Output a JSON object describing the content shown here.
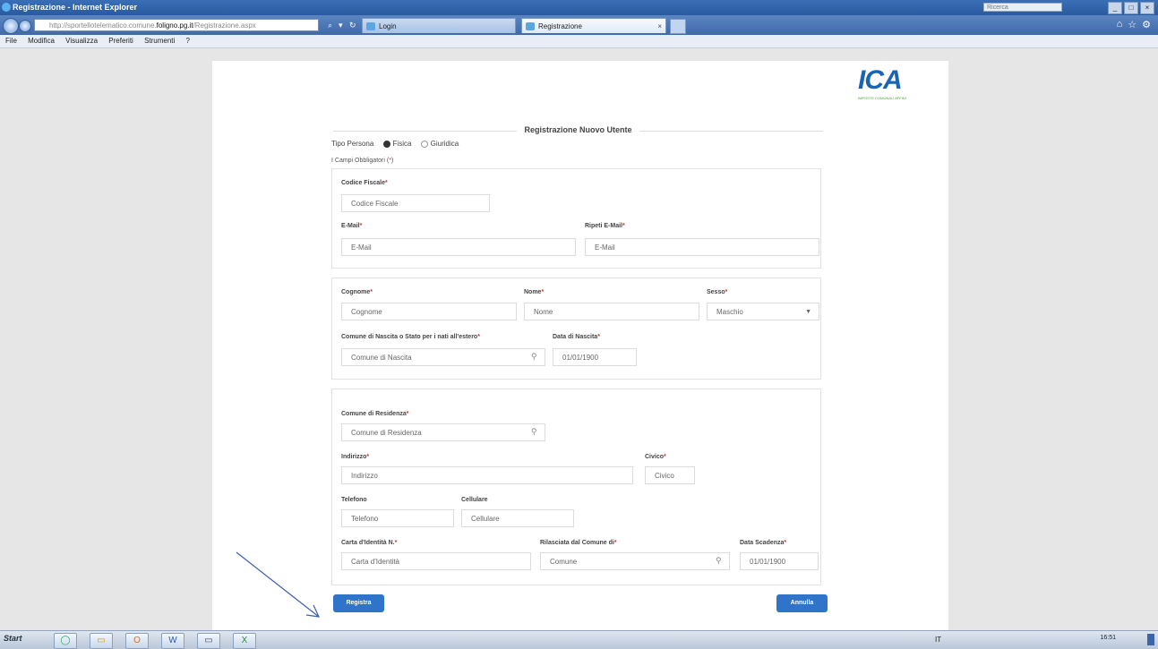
{
  "window": {
    "title": "Registrazione - Internet Explorer",
    "search_placeholder": "Ricerca",
    "buttons": [
      "_",
      "□",
      "×"
    ]
  },
  "browser": {
    "address_prefix": "http://sportellotelematico.comune.",
    "address_domain": "foligno.pg.it",
    "address_suffix": "/Registrazione.aspx",
    "search_glyph": "⌕",
    "go_glyph": "▾",
    "refresh_glyph": "↻",
    "tabs": [
      {
        "label": "Login",
        "close": ""
      },
      {
        "label": "Registrazione",
        "close": "×"
      }
    ],
    "right_icons": [
      "⌂",
      "☆",
      "⚙"
    ]
  },
  "menu": [
    "File",
    "Modifica",
    "Visualizza",
    "Preferiti",
    "Strumenti",
    "?"
  ],
  "logo": {
    "text": "ICA",
    "tagline": "IMPOSTE COMUNALI AFFINI"
  },
  "form": {
    "title": "Registrazione Nuovo Utente",
    "tipo_label": "Tipo Persona",
    "tipo_options": [
      "Fisica",
      "Giuridica"
    ],
    "tipo_selected": "Fisica",
    "required_note": "I Campi Obbligatori (",
    "star": "*",
    "required_close": ")",
    "section1": {
      "codice_fiscale_label": "Codice Fiscale",
      "codice_fiscale_placeholder": "Codice Fiscale",
      "email_label": "E-Mail",
      "email_placeholder": "E-Mail",
      "ripeti_email_label": "Ripeti E-Mail",
      "ripeti_email_placeholder": "E-Mail"
    },
    "section2": {
      "cognome_label": "Cognome",
      "cognome_placeholder": "Cognome",
      "nome_label": "Nome",
      "nome_placeholder": "Nome",
      "sesso_label": "Sesso",
      "sesso_value": "Maschio",
      "comune_nascita_label": "Comune di Nascita o Stato per i nati all'estero",
      "comune_nascita_placeholder": "Comune di Nascita",
      "data_nascita_label": "Data di Nascita",
      "data_nascita_value": "01/01/1900"
    },
    "section3": {
      "comune_residenza_label": "Comune di Residenza",
      "comune_residenza_placeholder": "Comune di Residenza",
      "indirizzo_label": "Indirizzo",
      "indirizzo_placeholder": "Indirizzo",
      "civico_label": "Civico",
      "civico_placeholder": "Civico",
      "telefono_label": "Telefono",
      "telefono_placeholder": "Telefono",
      "cellulare_label": "Cellulare",
      "cellulare_placeholder": "Cellulare",
      "carta_label": "Carta d'Identità N.",
      "carta_placeholder": "Carta d'Identità",
      "rilasciata_label": "Rilasciata dal Comune di",
      "rilasciata_placeholder": "Comune",
      "scadenza_label": "Data Scadenza",
      "scadenza_value": "01/01/1900"
    },
    "search_glyph": "⚲",
    "buttons": {
      "register": "Registra",
      "cancel": "Annulla"
    }
  },
  "taskbar": {
    "start": "Start",
    "icons": [
      "◯",
      "▭",
      "O",
      "W",
      "▭",
      "X"
    ],
    "language": "IT",
    "clock_time": "16:51"
  },
  "colors": {
    "accent": "#2f74c8",
    "brand": "#1a64b5",
    "required": "#cc3333"
  }
}
